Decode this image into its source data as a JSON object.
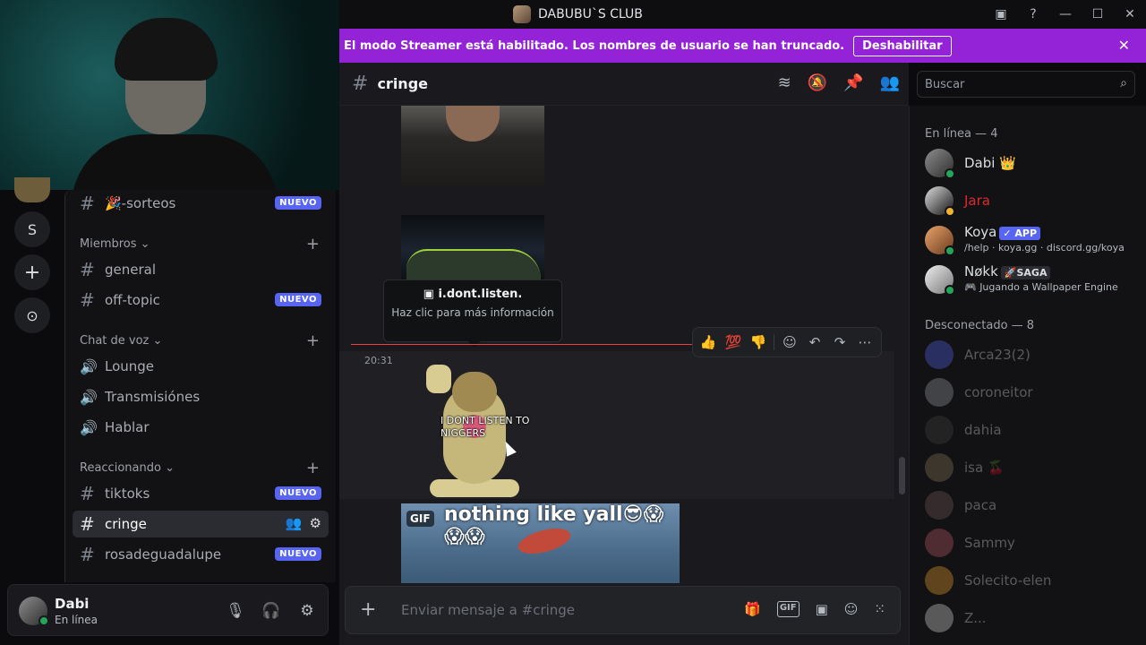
{
  "window": {
    "title": "DABUBU`S CLUB",
    "inbox_icon": "inbox-icon",
    "help_icon": "help-icon"
  },
  "banner": {
    "text": "El modo Streamer está habilitado. Los nombres de usuario se han truncado.",
    "button": "Deshabilitar",
    "close": "✕"
  },
  "rail": {
    "server_letter": "S",
    "add": "+",
    "discover": "⊙"
  },
  "sidebar": {
    "channels": [
      {
        "label": "🎉-sorteos",
        "badge": "NUEVO"
      },
      {
        "category": "Miembros"
      },
      {
        "label": "general"
      },
      {
        "label": "off-topic",
        "badge": "NUEVO"
      },
      {
        "category": "Chat de voz"
      },
      {
        "label": "Lounge"
      },
      {
        "label": "Transmisiónes"
      },
      {
        "label": "Hablar"
      },
      {
        "category": "Reaccionando"
      },
      {
        "label": "tiktoks",
        "badge": "NUEVO"
      },
      {
        "label": "cringe"
      },
      {
        "label": "rosadeguadalupe",
        "badge": "NUEVO"
      }
    ]
  },
  "user": {
    "name": "Dabi",
    "status": "En línea"
  },
  "chat": {
    "channel": "cringe",
    "search_placeholder": "Buscar",
    "tooltip_title": "i.dont.listen.",
    "tooltip_body": "Haz clic para más información",
    "timestamp": "20:31",
    "sticker_text": "I DONT LISTEN TO NIGGERS",
    "gif_tag": "GIF",
    "gif_caption": "nothing like yall😎😱😱😱",
    "reactions": [
      "👍",
      "💯",
      "👎"
    ],
    "composer_placeholder": "Enviar mensaje a #cringe"
  },
  "members": {
    "online_header": "En línea — 4",
    "offline_header": "Desconectado — 8",
    "online": [
      {
        "name": "Dabi 👑",
        "color": "#dbdee1"
      },
      {
        "name": "Jara",
        "color": "#e0282e"
      },
      {
        "name": "Koya",
        "tag": "✓ APP",
        "sub": "/help · koya.gg · discord.gg/koya"
      },
      {
        "name": "Nøkk",
        "tag": "🚀SAGA",
        "sub": "🎮 Jugando a Wallpaper Engine"
      }
    ],
    "offline": [
      "Arca23(2)",
      "coroneitor",
      "dahia",
      "isa 🍒",
      "paca",
      "Sammy",
      "Solecito-elen",
      "Z..."
    ]
  }
}
